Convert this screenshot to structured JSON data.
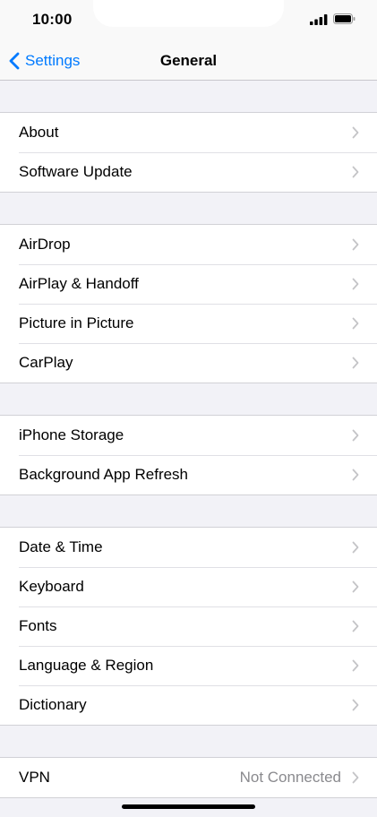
{
  "status_bar": {
    "time": "10:00"
  },
  "nav": {
    "back_label": "Settings",
    "title": "General"
  },
  "groups": [
    {
      "rows": [
        {
          "label": "About"
        },
        {
          "label": "Software Update"
        }
      ]
    },
    {
      "rows": [
        {
          "label": "AirDrop"
        },
        {
          "label": "AirPlay & Handoff"
        },
        {
          "label": "Picture in Picture"
        },
        {
          "label": "CarPlay"
        }
      ]
    },
    {
      "rows": [
        {
          "label": "iPhone Storage"
        },
        {
          "label": "Background App Refresh"
        }
      ]
    },
    {
      "rows": [
        {
          "label": "Date & Time"
        },
        {
          "label": "Keyboard"
        },
        {
          "label": "Fonts"
        },
        {
          "label": "Language & Region"
        },
        {
          "label": "Dictionary"
        }
      ]
    },
    {
      "rows": [
        {
          "label": "VPN",
          "value": "Not Connected"
        }
      ]
    }
  ],
  "colors": {
    "accent": "#007aff",
    "background": "#f2f2f7",
    "chevron": "#c4c4c7",
    "secondary_text": "#8a8a8e"
  }
}
